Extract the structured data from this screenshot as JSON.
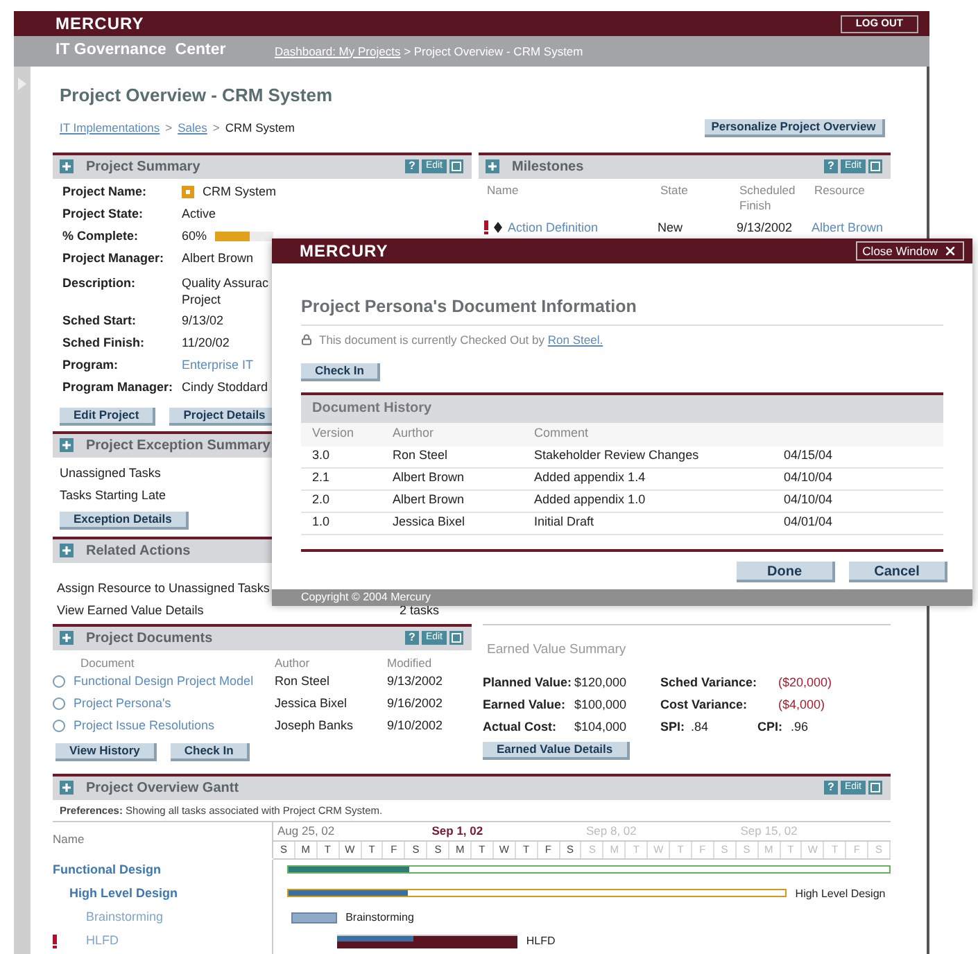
{
  "header": {
    "logo": "MERCURY",
    "logout": "LOG OUT",
    "app_title": "IT Governance  Center",
    "breadcrumb_link": "Dashboard: My Projects",
    "breadcrumb_rest": " > Project Overview - CRM System"
  },
  "page": {
    "title": "Project Overview - CRM System",
    "separator": ">",
    "breadcrumb": [
      {
        "label": "IT Implementations",
        "link": true
      },
      {
        "label": "Sales",
        "link": true
      },
      {
        "label": "CRM System",
        "link": false
      }
    ],
    "personalize_button": "Personalize Project Overview"
  },
  "project_summary": {
    "title": "Project Summary",
    "tools": [
      {
        "kind": "help",
        "label": "?"
      },
      {
        "kind": "edit",
        "label": "Edit"
      },
      {
        "kind": "minimize"
      }
    ],
    "fields": [
      {
        "label": "Project Name:",
        "value": "CRM System",
        "kind": "icon_text"
      },
      {
        "label": "Project State:",
        "value": "Active",
        "kind": "text"
      },
      {
        "label": "% Complete:",
        "value": "60%",
        "kind": "progress",
        "level": 0.6
      },
      {
        "label": "Project Manager:",
        "value": "Albert Brown",
        "kind": "text"
      },
      {
        "label": "Description:",
        "value": "Quality Assurac\nProject",
        "kind": "text"
      },
      {
        "label": "Sched Start:",
        "value": "9/13/02",
        "kind": "text"
      },
      {
        "label": "Sched Finish:",
        "value": "11/20/02",
        "kind": "text"
      },
      {
        "label": "Program:",
        "value": "Enterprise IT",
        "kind": "link"
      },
      {
        "label": "Program Manager:",
        "value": "Cindy Stoddard",
        "kind": "text"
      }
    ],
    "buttons": [
      "Edit Project",
      "Project Details"
    ]
  },
  "exception_summary": {
    "title": "Project Exception Summary",
    "rows": [
      "Unassigned Tasks",
      "Tasks Starting Late"
    ],
    "button": "Exception Details"
  },
  "related_actions": {
    "title": "Related Actions",
    "rows": [
      {
        "label": "Assign Resource to Unassigned Tasks"
      },
      {
        "label": "View Earned Value Details",
        "count": "2 tasks"
      }
    ]
  },
  "milestones": {
    "title": "Milestones",
    "tools": [
      {
        "kind": "help",
        "label": "?"
      },
      {
        "kind": "edit",
        "label": "Edit"
      },
      {
        "kind": "minimize"
      }
    ],
    "columns": [
      "Name",
      "State",
      "Scheduled Finish",
      "Resource"
    ],
    "rows": [
      {
        "flagged": true,
        "name": "Action Definition",
        "state": "New",
        "finish": "9/13/2002",
        "resource": "Albert Brown"
      }
    ]
  },
  "documents": {
    "title": "Project Documents",
    "tools": [
      {
        "kind": "help",
        "label": "?"
      },
      {
        "kind": "edit",
        "label": "Edit"
      },
      {
        "kind": "minimize"
      }
    ],
    "columns": [
      "Document",
      "Author",
      "Modified"
    ],
    "rows": [
      {
        "name": "Functional Design Project Model",
        "author": "Ron Steel",
        "modified": "9/13/2002",
        "selected": false
      },
      {
        "name": "Project Persona's",
        "author": "Jessica Bixel",
        "modified": "9/16/2002",
        "selected": false
      },
      {
        "name": "Project Issue Resolutions",
        "author": "Joseph Banks",
        "modified": "9/10/2002",
        "selected": false
      }
    ],
    "buttons": [
      "View History",
      "Check In"
    ]
  },
  "earned_value": {
    "title": "Earned Value Summary",
    "rows": [
      [
        {
          "label": "Planned Value:",
          "value": "$120,000",
          "negative": false
        },
        {
          "label": "Sched Variance:",
          "value": "($20,000)",
          "negative": true
        }
      ],
      [
        {
          "label": "Earned Value:",
          "value": "$100,000",
          "negative": false
        },
        {
          "label": "Cost Variance:",
          "value": "($4,000)",
          "negative": true
        }
      ],
      [
        {
          "label": "Actual Cost:",
          "value": "$104,000",
          "negative": false
        },
        {
          "label": "SPI:",
          "value": ".84",
          "negative": false
        },
        {
          "label": "CPI:",
          "value": ".96",
          "negative": false
        }
      ]
    ],
    "button": "Earned Value Details"
  },
  "gantt": {
    "title": "Project Overview Gantt",
    "tools": [
      {
        "kind": "help",
        "label": "?"
      },
      {
        "kind": "edit",
        "label": "Edit"
      },
      {
        "kind": "minimize"
      }
    ],
    "preferences": "**Preferences:** Showing all tasks associated with Project CRM System.",
    "name_column": "Name",
    "weeks": [
      {
        "label": "Aug 25, 02",
        "current": false,
        "dimmed": false,
        "days": [
          "S",
          "M",
          "T",
          "W",
          "T",
          "F",
          "S"
        ]
      },
      {
        "label": "Sep 1, 02",
        "current": true,
        "dimmed": false,
        "days": [
          "S",
          "M",
          "T",
          "W",
          "T",
          "F",
          "S"
        ]
      },
      {
        "label": "Sep 8, 02",
        "current": false,
        "dimmed": true,
        "days": [
          "S",
          "M",
          "T",
          "W",
          "T",
          "F",
          "S"
        ]
      },
      {
        "label": "Sep 15, 02",
        "current": false,
        "dimmed": true,
        "days": [
          "S",
          "M",
          "T",
          "W",
          "T",
          "F",
          "S"
        ]
      }
    ],
    "tasks": [
      {
        "name": "Functional Design",
        "kind": "phase",
        "flagged": false,
        "level": 0.2,
        "children": [
          {
            "name": "High Level Design",
            "kind": "summary",
            "flagged": false,
            "level": 0.24,
            "bar_label": "High Level Design",
            "children": [
              {
                "name": "Brainstorming",
                "kind": "task",
                "flagged": false,
                "level": 1,
                "bar_label": "Brainstorming"
              },
              {
                "name": "HLFD",
                "kind": "critical",
                "flagged": true,
                "level": 0.42,
                "bar_label": "HLFD"
              }
            ]
          }
        ]
      }
    ]
  },
  "modal": {
    "logo": "MERCURY",
    "close": "Close Window",
    "title": "Project Persona's Document Information",
    "status": "This document is currently Checked Out by ",
    "status_link": "Ron Steel.",
    "check_in": "Check In",
    "history": {
      "title": "Document History",
      "columns": [
        "Version",
        "Aurthor",
        "Comment"
      ],
      "rows": [
        {
          "version": "3.0",
          "author": "Ron Steel",
          "comment": "Stakeholder Review Changes",
          "date": "04/15/04"
        },
        {
          "version": "2.1",
          "author": "Albert Brown",
          "comment": "Added appendix 1.4",
          "date": "04/10/04"
        },
        {
          "version": "2.0",
          "author": "Albert Brown",
          "comment": "Added appendix 1.0",
          "date": "04/10/04"
        },
        {
          "version": "1.0",
          "author": "Jessica Bixel",
          "comment": "Initial Draft",
          "date": "04/01/04"
        }
      ]
    },
    "buttons": [
      "Done",
      "Cancel"
    ],
    "footer": "Copyright © 2004 Mercury"
  }
}
